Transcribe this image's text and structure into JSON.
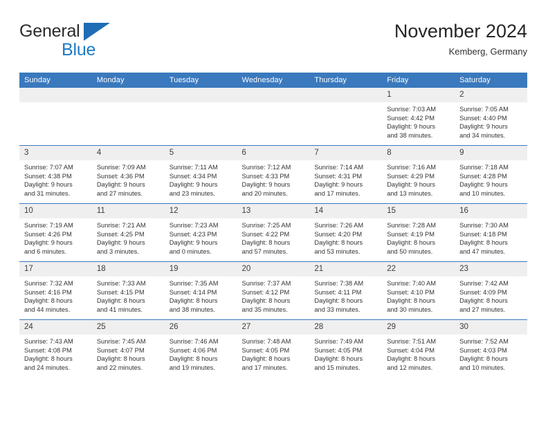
{
  "brand": {
    "name_top": "General",
    "name_bottom": "Blue",
    "triangle_icon": "blue-triangle-icon",
    "accent_color": "#1b7ac4"
  },
  "header": {
    "title": "November 2024",
    "subtitle": "Kemberg, Germany"
  },
  "theme": {
    "header_blue": "#3a79bd",
    "daynum_gray": "#efefef",
    "text": "#333333"
  },
  "weekdays": [
    "Sunday",
    "Monday",
    "Tuesday",
    "Wednesday",
    "Thursday",
    "Friday",
    "Saturday"
  ],
  "weeks": [
    [
      {
        "day": "",
        "sunrise": "",
        "sunset": "",
        "daylight_line1": "",
        "daylight_line2": ""
      },
      {
        "day": "",
        "sunrise": "",
        "sunset": "",
        "daylight_line1": "",
        "daylight_line2": ""
      },
      {
        "day": "",
        "sunrise": "",
        "sunset": "",
        "daylight_line1": "",
        "daylight_line2": ""
      },
      {
        "day": "",
        "sunrise": "",
        "sunset": "",
        "daylight_line1": "",
        "daylight_line2": ""
      },
      {
        "day": "",
        "sunrise": "",
        "sunset": "",
        "daylight_line1": "",
        "daylight_line2": ""
      },
      {
        "day": "1",
        "sunrise": "Sunrise: 7:03 AM",
        "sunset": "Sunset: 4:42 PM",
        "daylight_line1": "Daylight: 9 hours",
        "daylight_line2": "and 38 minutes."
      },
      {
        "day": "2",
        "sunrise": "Sunrise: 7:05 AM",
        "sunset": "Sunset: 4:40 PM",
        "daylight_line1": "Daylight: 9 hours",
        "daylight_line2": "and 34 minutes."
      }
    ],
    [
      {
        "day": "3",
        "sunrise": "Sunrise: 7:07 AM",
        "sunset": "Sunset: 4:38 PM",
        "daylight_line1": "Daylight: 9 hours",
        "daylight_line2": "and 31 minutes."
      },
      {
        "day": "4",
        "sunrise": "Sunrise: 7:09 AM",
        "sunset": "Sunset: 4:36 PM",
        "daylight_line1": "Daylight: 9 hours",
        "daylight_line2": "and 27 minutes."
      },
      {
        "day": "5",
        "sunrise": "Sunrise: 7:11 AM",
        "sunset": "Sunset: 4:34 PM",
        "daylight_line1": "Daylight: 9 hours",
        "daylight_line2": "and 23 minutes."
      },
      {
        "day": "6",
        "sunrise": "Sunrise: 7:12 AM",
        "sunset": "Sunset: 4:33 PM",
        "daylight_line1": "Daylight: 9 hours",
        "daylight_line2": "and 20 minutes."
      },
      {
        "day": "7",
        "sunrise": "Sunrise: 7:14 AM",
        "sunset": "Sunset: 4:31 PM",
        "daylight_line1": "Daylight: 9 hours",
        "daylight_line2": "and 17 minutes."
      },
      {
        "day": "8",
        "sunrise": "Sunrise: 7:16 AM",
        "sunset": "Sunset: 4:29 PM",
        "daylight_line1": "Daylight: 9 hours",
        "daylight_line2": "and 13 minutes."
      },
      {
        "day": "9",
        "sunrise": "Sunrise: 7:18 AM",
        "sunset": "Sunset: 4:28 PM",
        "daylight_line1": "Daylight: 9 hours",
        "daylight_line2": "and 10 minutes."
      }
    ],
    [
      {
        "day": "10",
        "sunrise": "Sunrise: 7:19 AM",
        "sunset": "Sunset: 4:26 PM",
        "daylight_line1": "Daylight: 9 hours",
        "daylight_line2": "and 6 minutes."
      },
      {
        "day": "11",
        "sunrise": "Sunrise: 7:21 AM",
        "sunset": "Sunset: 4:25 PM",
        "daylight_line1": "Daylight: 9 hours",
        "daylight_line2": "and 3 minutes."
      },
      {
        "day": "12",
        "sunrise": "Sunrise: 7:23 AM",
        "sunset": "Sunset: 4:23 PM",
        "daylight_line1": "Daylight: 9 hours",
        "daylight_line2": "and 0 minutes."
      },
      {
        "day": "13",
        "sunrise": "Sunrise: 7:25 AM",
        "sunset": "Sunset: 4:22 PM",
        "daylight_line1": "Daylight: 8 hours",
        "daylight_line2": "and 57 minutes."
      },
      {
        "day": "14",
        "sunrise": "Sunrise: 7:26 AM",
        "sunset": "Sunset: 4:20 PM",
        "daylight_line1": "Daylight: 8 hours",
        "daylight_line2": "and 53 minutes."
      },
      {
        "day": "15",
        "sunrise": "Sunrise: 7:28 AM",
        "sunset": "Sunset: 4:19 PM",
        "daylight_line1": "Daylight: 8 hours",
        "daylight_line2": "and 50 minutes."
      },
      {
        "day": "16",
        "sunrise": "Sunrise: 7:30 AM",
        "sunset": "Sunset: 4:18 PM",
        "daylight_line1": "Daylight: 8 hours",
        "daylight_line2": "and 47 minutes."
      }
    ],
    [
      {
        "day": "17",
        "sunrise": "Sunrise: 7:32 AM",
        "sunset": "Sunset: 4:16 PM",
        "daylight_line1": "Daylight: 8 hours",
        "daylight_line2": "and 44 minutes."
      },
      {
        "day": "18",
        "sunrise": "Sunrise: 7:33 AM",
        "sunset": "Sunset: 4:15 PM",
        "daylight_line1": "Daylight: 8 hours",
        "daylight_line2": "and 41 minutes."
      },
      {
        "day": "19",
        "sunrise": "Sunrise: 7:35 AM",
        "sunset": "Sunset: 4:14 PM",
        "daylight_line1": "Daylight: 8 hours",
        "daylight_line2": "and 38 minutes."
      },
      {
        "day": "20",
        "sunrise": "Sunrise: 7:37 AM",
        "sunset": "Sunset: 4:12 PM",
        "daylight_line1": "Daylight: 8 hours",
        "daylight_line2": "and 35 minutes."
      },
      {
        "day": "21",
        "sunrise": "Sunrise: 7:38 AM",
        "sunset": "Sunset: 4:11 PM",
        "daylight_line1": "Daylight: 8 hours",
        "daylight_line2": "and 33 minutes."
      },
      {
        "day": "22",
        "sunrise": "Sunrise: 7:40 AM",
        "sunset": "Sunset: 4:10 PM",
        "daylight_line1": "Daylight: 8 hours",
        "daylight_line2": "and 30 minutes."
      },
      {
        "day": "23",
        "sunrise": "Sunrise: 7:42 AM",
        "sunset": "Sunset: 4:09 PM",
        "daylight_line1": "Daylight: 8 hours",
        "daylight_line2": "and 27 minutes."
      }
    ],
    [
      {
        "day": "24",
        "sunrise": "Sunrise: 7:43 AM",
        "sunset": "Sunset: 4:08 PM",
        "daylight_line1": "Daylight: 8 hours",
        "daylight_line2": "and 24 minutes."
      },
      {
        "day": "25",
        "sunrise": "Sunrise: 7:45 AM",
        "sunset": "Sunset: 4:07 PM",
        "daylight_line1": "Daylight: 8 hours",
        "daylight_line2": "and 22 minutes."
      },
      {
        "day": "26",
        "sunrise": "Sunrise: 7:46 AM",
        "sunset": "Sunset: 4:06 PM",
        "daylight_line1": "Daylight: 8 hours",
        "daylight_line2": "and 19 minutes."
      },
      {
        "day": "27",
        "sunrise": "Sunrise: 7:48 AM",
        "sunset": "Sunset: 4:05 PM",
        "daylight_line1": "Daylight: 8 hours",
        "daylight_line2": "and 17 minutes."
      },
      {
        "day": "28",
        "sunrise": "Sunrise: 7:49 AM",
        "sunset": "Sunset: 4:05 PM",
        "daylight_line1": "Daylight: 8 hours",
        "daylight_line2": "and 15 minutes."
      },
      {
        "day": "29",
        "sunrise": "Sunrise: 7:51 AM",
        "sunset": "Sunset: 4:04 PM",
        "daylight_line1": "Daylight: 8 hours",
        "daylight_line2": "and 12 minutes."
      },
      {
        "day": "30",
        "sunrise": "Sunrise: 7:52 AM",
        "sunset": "Sunset: 4:03 PM",
        "daylight_line1": "Daylight: 8 hours",
        "daylight_line2": "and 10 minutes."
      }
    ]
  ]
}
